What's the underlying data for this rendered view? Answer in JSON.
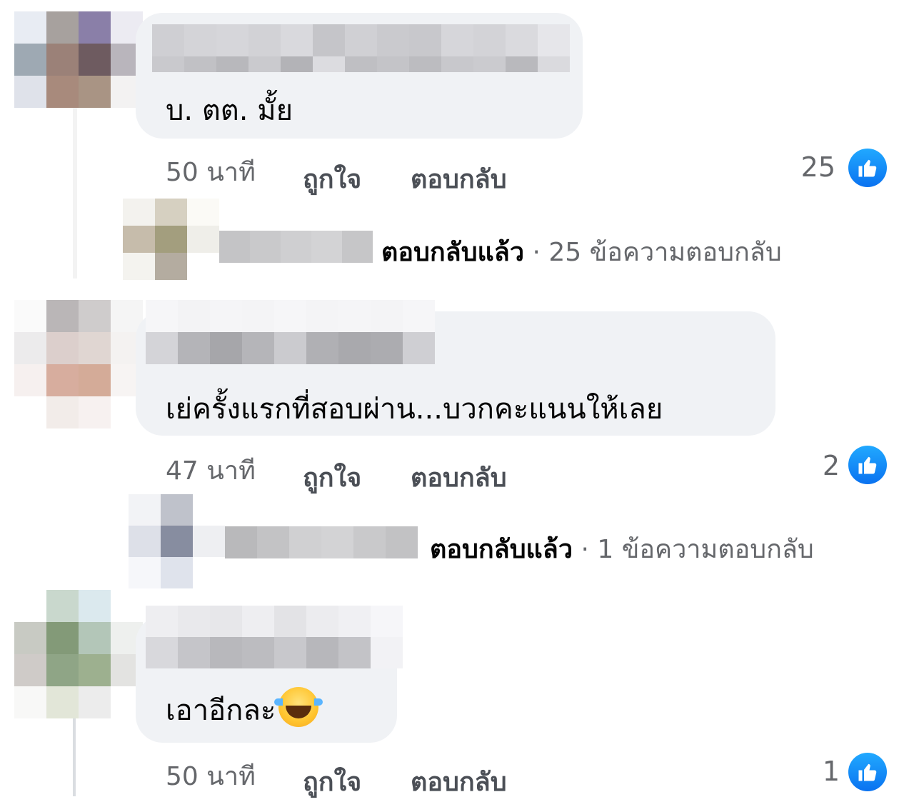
{
  "colors": {
    "bubble": "#f0f2f5",
    "like_blue": "#1877f2",
    "meta_gray": "#65676b"
  },
  "comments": [
    {
      "text": "บ. ตต. มั้ย",
      "time": "50 นาที",
      "like_label": "ถูกใจ",
      "reply_label": "ตอบกลับ",
      "like_count": "25",
      "replies": {
        "replied_label": "ตอบกลับแล้ว",
        "separator": "·",
        "count_text": "25 ข้อความตอบกลับ"
      }
    },
    {
      "text": "เย่ครั้งแรกที่สอบผ่าน...บวกคะแนนให้เลย",
      "time": "47 นาที",
      "like_label": "ถูกใจ",
      "reply_label": "ตอบกลับ",
      "like_count": "2",
      "replies": {
        "replied_label": "ตอบกลับแล้ว",
        "separator": "·",
        "count_text": "1 ข้อความตอบกลับ"
      }
    },
    {
      "text": "เอาอีกละ",
      "emoji": "face-with-tears-of-joy",
      "time": "50 นาที",
      "like_label": "ถูกใจ",
      "reply_label": "ตอบกลับ",
      "like_count": "1"
    }
  ]
}
